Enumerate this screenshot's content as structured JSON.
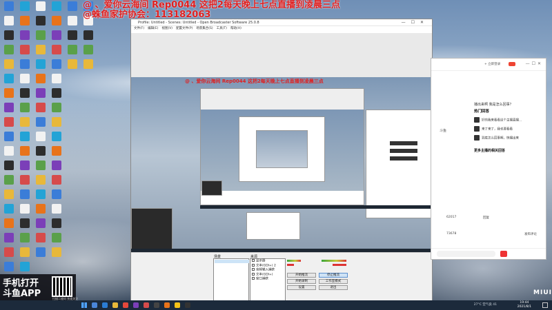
{
  "stream_overlay": {
    "line1": "@ 、爱你云海间   Rep0044  这把2每天晚上七点直播到凌晨三点",
    "line2": "@蛛鱼家护协会：113182063"
  },
  "obs": {
    "title": "Profile: Untitled - Scenes: Untitled - Open Broadcaster Software 25.0.8",
    "menu": [
      "文件(F)",
      "编辑(E)",
      "视图(V)",
      "配置文件(P)",
      "场景集合(S)",
      "工具(T)",
      "帮助(H)"
    ],
    "scenes_title": "场景",
    "sources_title": "来源",
    "sources": [
      "显示器",
      "文本(GDI+) 2",
      "音频输入捕获",
      "文本(GDI+)",
      "窗口捕获"
    ],
    "controls": {
      "start_stream": "开始推流",
      "stop_stream": "停止推流",
      "start_record": "开始录制",
      "studio_mode": "工作室模式",
      "settings": "设置",
      "exit": "退出"
    }
  },
  "douyu": {
    "login": "+ 立即登录",
    "question": "播出来啊  我是怎么回事？",
    "answers_title": "热门回答",
    "answers": [
      "好的我来看看这个主播直播...",
      "来了来了，我也要看看",
      "到底怎么回事啊，快播出来"
    ],
    "related_title": "更多主播的相关回答",
    "tag": "斗鱼",
    "stats": [
      "62017",
      "73678"
    ],
    "reply_label": "回复",
    "post_label": "发布评论"
  },
  "ad": {
    "line1": "手机打开",
    "line2": "斗鱼APP",
    "caption": "扫描二维码 快速关注"
  },
  "taskbar": {
    "tray": "27°C  空气良  41",
    "time": "19:44",
    "date": "2021/8/1"
  },
  "brand": "MIUI",
  "colors": {
    "overlay_red": "#e02020",
    "taskbar": "#1c2a3b",
    "douyu_red": "#e33333"
  }
}
